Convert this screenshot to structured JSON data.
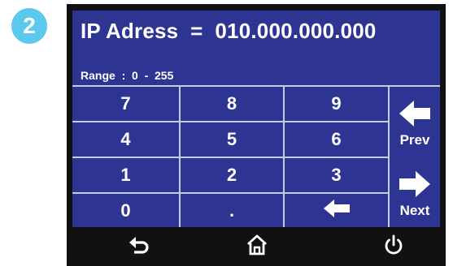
{
  "step_badge": "2",
  "screen": {
    "title": "IP Adress  =  010.000.000.000",
    "range": "Range  :  0  -  255"
  },
  "keypad": {
    "rows": [
      [
        "7",
        "8",
        "9"
      ],
      [
        "4",
        "5",
        "6"
      ],
      [
        "1",
        "2",
        "3"
      ],
      [
        "0",
        ".",
        ""
      ]
    ],
    "prev_label": "Prev",
    "next_label": "Next"
  },
  "bottom_bar": {
    "icons": [
      "back-icon",
      "home-icon",
      "power-icon"
    ]
  },
  "colors": {
    "screen_bg": "#2e3491",
    "grid_lines": "#c9cbe6",
    "badge": "#5bc8ee",
    "bezel": "#111111"
  }
}
